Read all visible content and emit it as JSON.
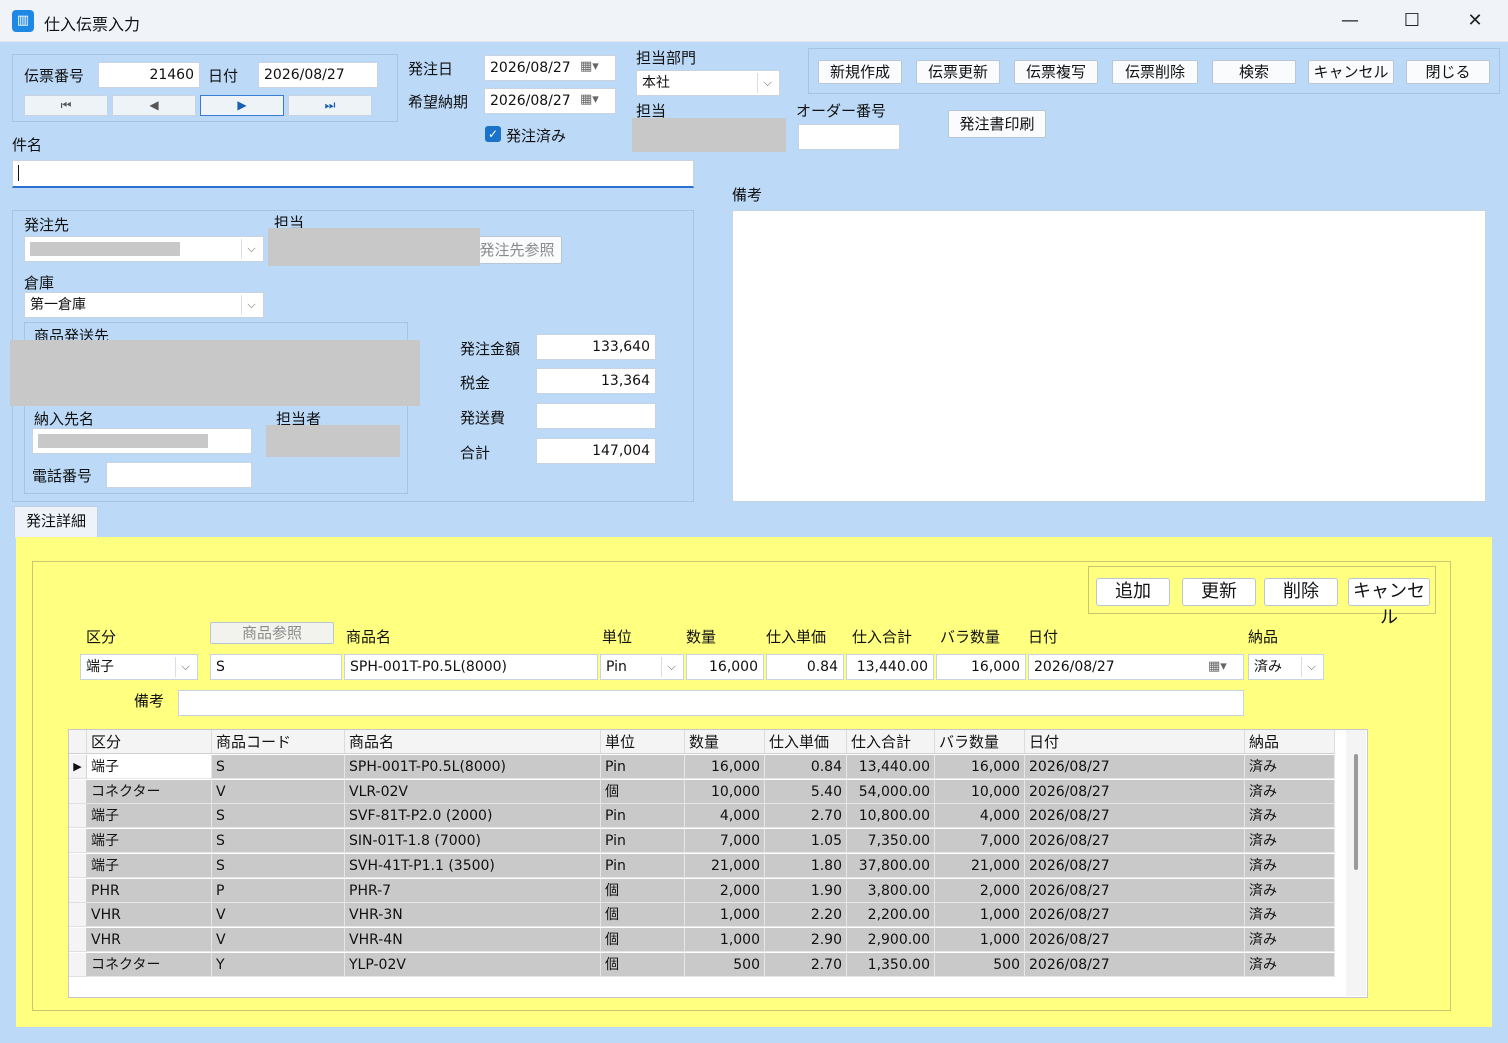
{
  "window": {
    "title": "仕入伝票入力",
    "minimize": "—",
    "maximize": "☐",
    "close": "✕"
  },
  "header": {
    "slip_no_label": "伝票番号",
    "slip_no": "21460",
    "date_label": "日付",
    "date": "2026/08/27",
    "order_date_label": "発注日",
    "order_date": "2026/08/27",
    "desired_delivery_label": "希望納期",
    "desired_delivery": "2026/08/27",
    "ordered_label": "発注済み",
    "dept_label": "担当部門",
    "dept": "本社",
    "person_label": "担当",
    "order_no_label": "オーダー番号",
    "order_no": "",
    "subject_label": "件名",
    "subject": ""
  },
  "nav": {
    "first": "⏮",
    "prev": "◀",
    "next": "▶",
    "last": "⏭"
  },
  "toolbar": {
    "new": "新規作成",
    "update": "伝票更新",
    "copy": "伝票複写",
    "delete": "伝票削除",
    "search": "検索",
    "cancel": "キャンセル",
    "close": "閉じる",
    "print": "発注書印刷"
  },
  "supplier": {
    "supplier_label": "発注先",
    "person_label": "担当",
    "supplier_ref_button": "発注先参照",
    "warehouse_label": "倉庫",
    "warehouse": "第一倉庫",
    "ship_to_label": "商品発送先",
    "delivery_name_label": "納入先名",
    "contact_label": "担当者",
    "phone_label": "電話番号",
    "phone": ""
  },
  "amounts": {
    "order_amount_label": "発注金額",
    "order_amount": "133,640",
    "tax_label": "税金",
    "tax": "13,364",
    "shipping_label": "発送費",
    "shipping": "",
    "total_label": "合計",
    "total": "147,004"
  },
  "remarks": {
    "label": "備考",
    "value": ""
  },
  "detail_tab": {
    "label": "発注詳細"
  },
  "detail_buttons": {
    "add": "追加",
    "update": "更新",
    "delete": "削除",
    "cancel": "キャンセル"
  },
  "detail_editor": {
    "category_label": "区分",
    "product_ref_button": "商品参照",
    "product_name_label": "商品名",
    "unit_label": "単位",
    "qty_label": "数量",
    "unit_price_label": "仕入単価",
    "subtotal_label": "仕入合計",
    "loose_qty_label": "バラ数量",
    "date_label": "日付",
    "delivered_label": "納品",
    "remarks_label": "備考",
    "category": "端子",
    "code": "S",
    "product_name": "SPH-001T-P0.5L(8000)",
    "unit": "Pin",
    "qty": "16,000",
    "unit_price": "0.84",
    "subtotal": "13,440.00",
    "loose_qty": "16,000",
    "date": "2026/08/27",
    "delivered": "済み",
    "remarks": ""
  },
  "grid": {
    "columns": [
      "区分",
      "商品コード",
      "商品名",
      "単位",
      "数量",
      "仕入単価",
      "仕入合計",
      "バラ数量",
      "日付",
      "納品"
    ],
    "rows": [
      [
        "端子",
        "S",
        "SPH-001T-P0.5L(8000)",
        "Pin",
        "16,000",
        "0.84",
        "13,440.00",
        "16,000",
        "2026/08/27",
        "済み"
      ],
      [
        "コネクター",
        "V",
        "VLR-02V",
        "個",
        "10,000",
        "5.40",
        "54,000.00",
        "10,000",
        "2026/08/27",
        "済み"
      ],
      [
        "端子",
        "S",
        "SVF-81T-P2.0 (2000)",
        "Pin",
        "4,000",
        "2.70",
        "10,800.00",
        "4,000",
        "2026/08/27",
        "済み"
      ],
      [
        "端子",
        "S",
        "SIN-01T-1.8 (7000)",
        "Pin",
        "7,000",
        "1.05",
        "7,350.00",
        "7,000",
        "2026/08/27",
        "済み"
      ],
      [
        "端子",
        "S",
        "SVH-41T-P1.1 (3500)",
        "Pin",
        "21,000",
        "1.80",
        "37,800.00",
        "21,000",
        "2026/08/27",
        "済み"
      ],
      [
        "PHR",
        "P",
        "PHR-7",
        "個",
        "2,000",
        "1.90",
        "3,800.00",
        "2,000",
        "2026/08/27",
        "済み"
      ],
      [
        "VHR",
        "V",
        "VHR-3N",
        "個",
        "1,000",
        "2.20",
        "2,200.00",
        "1,000",
        "2026/08/27",
        "済み"
      ],
      [
        "VHR",
        "V",
        "VHR-4N",
        "個",
        "1,000",
        "2.90",
        "2,900.00",
        "1,000",
        "2026/08/27",
        "済み"
      ],
      [
        "コネクター",
        "Y",
        "YLP-02V",
        "個",
        "500",
        "2.70",
        "1,350.00",
        "500",
        "2026/08/27",
        "済み"
      ]
    ],
    "current_row_marker": "▶"
  }
}
